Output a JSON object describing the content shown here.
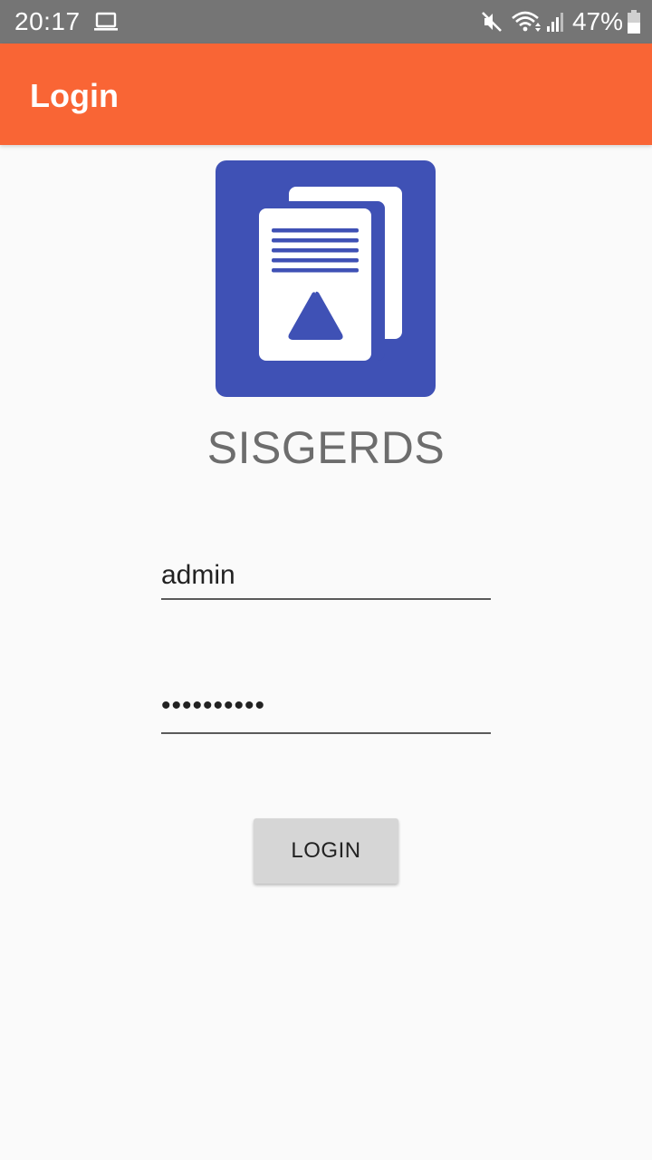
{
  "status_bar": {
    "time": "20:17",
    "battery_percent": "47%",
    "icons": [
      "laptop-icon",
      "mute-icon",
      "wifi-icon",
      "signal-icon",
      "battery-icon"
    ]
  },
  "app_bar": {
    "title": "Login",
    "color": "#f96535"
  },
  "logo": {
    "icon": "documents-logo-icon",
    "color": "#3f51b5"
  },
  "app_name": "SISGERDS",
  "form": {
    "username_value": "admin",
    "password_masked": "••••••••••"
  },
  "login_button_label": "LOGIN"
}
